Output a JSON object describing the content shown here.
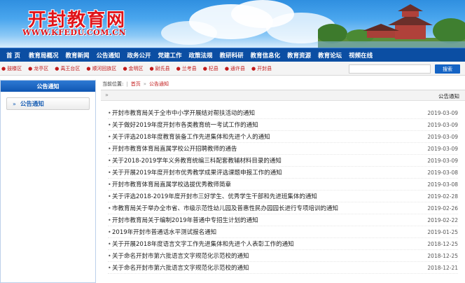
{
  "header": {
    "title": "开封教育网",
    "url": "WWW.KFEDU.COM.CN"
  },
  "main_nav": [
    "首 页",
    "教育局概况",
    "教育新闻",
    "公告通知",
    "政务公开",
    "党建工作",
    "政策法规",
    "教研科研",
    "教育信息化",
    "教育资源",
    "教育论坛",
    "视频在线"
  ],
  "sub_nav": [
    "鼓楼区",
    "龙亭区",
    "禹王台区",
    "顺河回族区",
    "金明区",
    "尉氏县",
    "兰考县",
    "杞县",
    "通许县",
    "开封县"
  ],
  "search": {
    "button": "搜索"
  },
  "sidebar": {
    "title": "公告通知",
    "items": [
      {
        "label": "公告通知"
      }
    ]
  },
  "breadcrumb": {
    "prefix": "当前位置:",
    "home": "首页",
    "current": "公告通知"
  },
  "panel": {
    "title": "公告通知"
  },
  "notices": [
    {
      "title": "开封市教育局关于全市中小学开展结对帮扶活动的通知",
      "date": "2019-03-09"
    },
    {
      "title": "关于做好2019年度开封市各类教育统一考试工作的通知",
      "date": "2019-03-09"
    },
    {
      "title": "关于评选2018年度教育装备工作先进集体和先进个人的通知",
      "date": "2019-03-09"
    },
    {
      "title": "开封市教育体育局直属学校公开招聘教师的通告",
      "date": "2019-03-09"
    },
    {
      "title": "关于2018-2019学年义务教育统编三科配套教辅材料目录的通知",
      "date": "2019-03-09"
    },
    {
      "title": "关于开展2019年度开封市优秀教学成果评选课题申报工作的通知",
      "date": "2019-03-08"
    },
    {
      "title": "开封市教育体育局直属学校选拔优秀教师简章",
      "date": "2019-03-08"
    },
    {
      "title": "关于评选2018-2019年度开封市三好学生、优秀学生干部和先进班集体的通知",
      "date": "2019-02-28"
    },
    {
      "title": "市教育局关于举办全市省、市级示范性幼儿园及普惠性民办园园长进行专项培训的通知",
      "date": "2019-02-26"
    },
    {
      "title": "开封市教育局关于编制2019年普通中专招生计划的通知",
      "date": "2019-02-22"
    },
    {
      "title": "2019年开封市普通话水平测试报名通知",
      "date": "2019-01-25"
    },
    {
      "title": "关于开展2018年度语言文字工作先进集体和先进个人表彰工作的通知",
      "date": "2018-12-25"
    },
    {
      "title": "关于命名开封市第六批语言文字规范化示范校的通知",
      "date": "2018-12-25"
    },
    {
      "title": "关于命名开封市第六批语言文字规范化示范校的通知",
      "date": "2018-12-21"
    }
  ],
  "colors": {
    "nav_bg": "#0b4ea3",
    "accent_red": "#c21a1a",
    "link_blue": "#1a5fb4"
  }
}
